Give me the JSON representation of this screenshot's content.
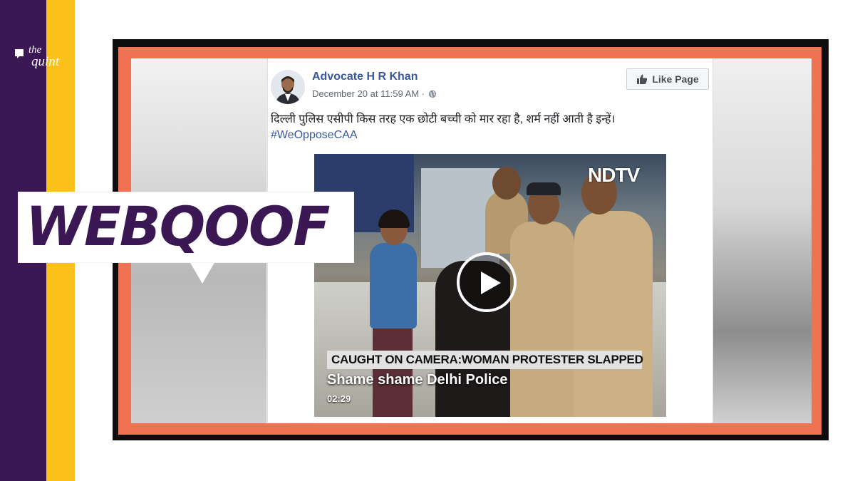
{
  "brand": {
    "logo_line1": "the",
    "logo_line2": "quint",
    "colors": {
      "purple": "#3b1754",
      "yellow": "#fcc21b",
      "orange_frame": "#ef7253"
    }
  },
  "badge": {
    "text": "WEBQOOF"
  },
  "post": {
    "author": "Advocate H R Khan",
    "timestamp": "December 20 at 11:59 AM · ",
    "privacy_icon": "globe-icon",
    "like_button": {
      "icon": "thumbs-up-icon",
      "label": "Like Page"
    },
    "text": "दिल्ली पुलिस एसीपी किस तरह एक छोटी बच्ची को मार रहा है, शर्म नहीं आती है इन्हें।",
    "hashtag": "#WeOpposeCAA"
  },
  "video": {
    "channel_logo": "NDTV",
    "caption_bar": "CAUGHT ON CAMERA:WOMAN PROTESTER SLAPPED",
    "title": "Shame shame Delhi Police",
    "duration": "02:29",
    "play_icon": "play-icon"
  }
}
